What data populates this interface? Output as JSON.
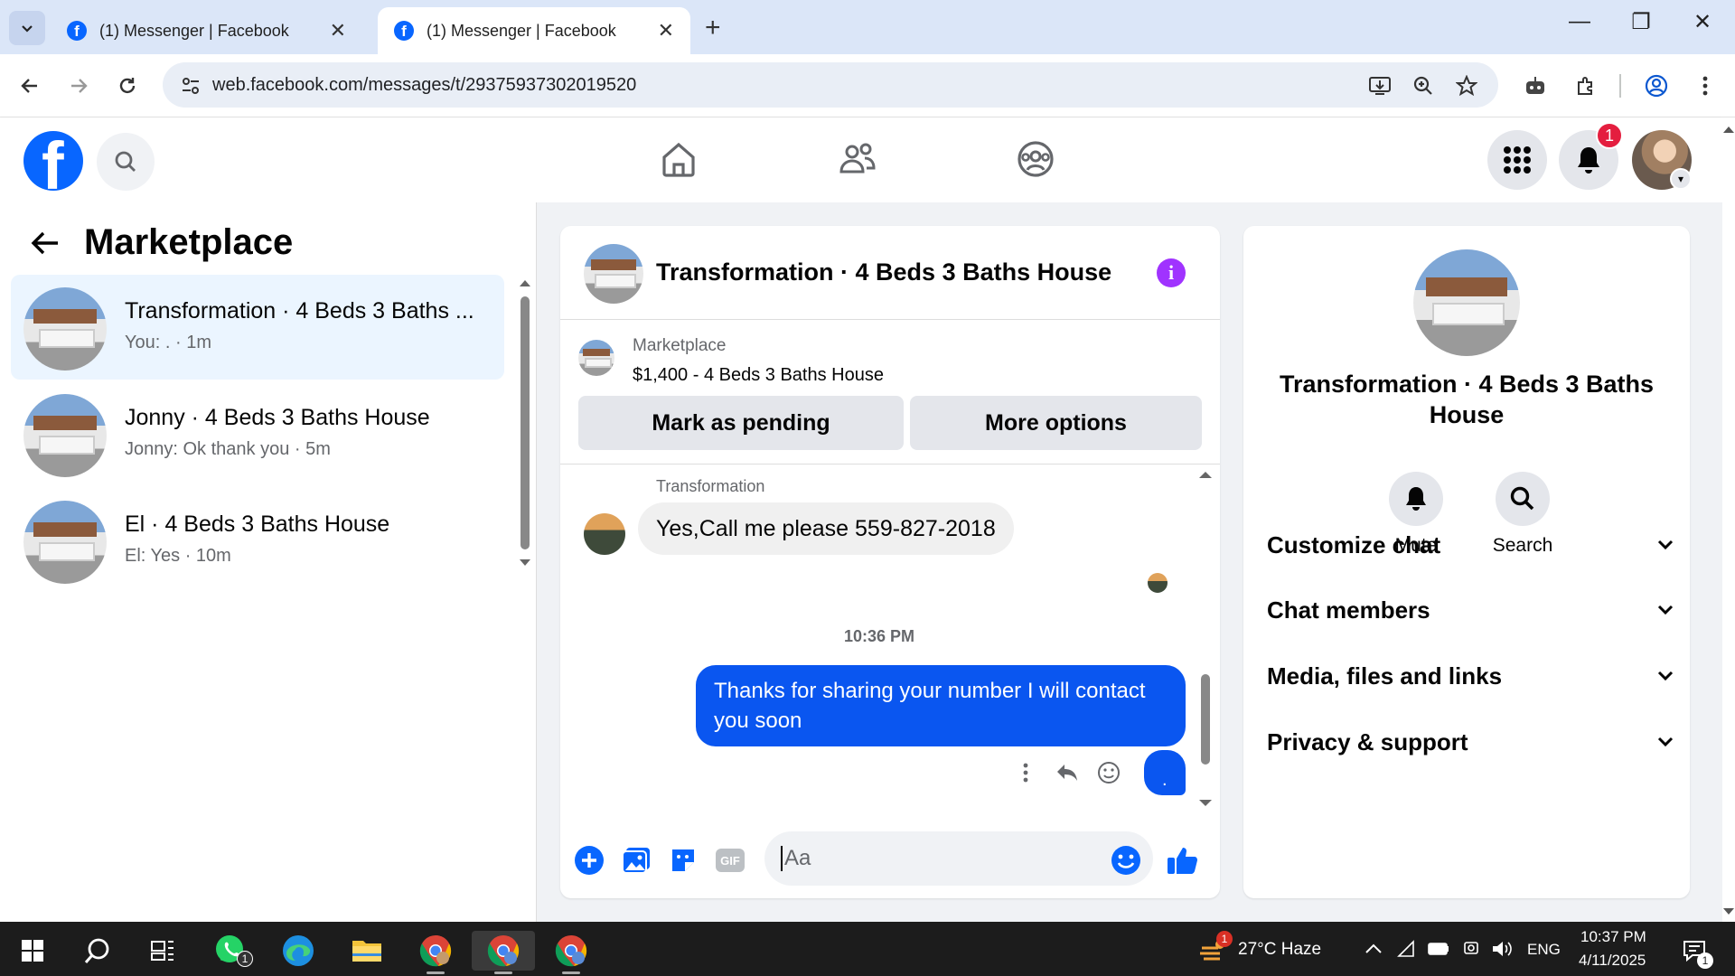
{
  "browser": {
    "tabs": [
      {
        "title": "(1) Messenger | Facebook",
        "active": false
      },
      {
        "title": "(1) Messenger | Facebook",
        "active": true
      }
    ],
    "url": "web.facebook.com/messages/t/29375937302019520"
  },
  "fb": {
    "logo_letter": "f",
    "notification_count": "1"
  },
  "left_panel": {
    "title": "Marketplace",
    "conversations": [
      {
        "name": "Transformation · 4 Beds 3 Baths ...",
        "snippet": "You: . · 1m",
        "active": true
      },
      {
        "name": "Jonny · 4 Beds 3 Baths House",
        "snippet": "Jonny: Ok thank you · 5m",
        "active": false
      },
      {
        "name": "El · 4 Beds 3 Baths House",
        "snippet": "El: Yes · 10m",
        "active": false
      }
    ]
  },
  "chat": {
    "title": "Transformation · 4 Beds 3 Baths House",
    "listing": {
      "category": "Marketplace",
      "price_title": "$1,400 - 4 Beds 3 Baths House",
      "mark_pending_label": "Mark as pending",
      "more_options_label": "More options"
    },
    "messages": {
      "sender": "Transformation",
      "incoming": "Yes,Call me please 559-827-2018",
      "timestamp": "10:36 PM",
      "outgoing": "Thanks for sharing your number I will contact you soon",
      "outgoing_mini": "."
    },
    "composer_placeholder": "Aa"
  },
  "right_panel": {
    "title": "Transformation · 4 Beds 3 Baths House",
    "actions": [
      {
        "label": "Mute",
        "icon": "bell-icon"
      },
      {
        "label": "Search",
        "icon": "search-icon"
      }
    ],
    "sections": [
      {
        "label": "Customize chat"
      },
      {
        "label": "Chat members"
      },
      {
        "label": "Media, files and links"
      },
      {
        "label": "Privacy & support"
      }
    ]
  },
  "taskbar": {
    "whatsapp_badge": "1",
    "weather_badge": "1",
    "weather": "27°C  Haze",
    "language": "ENG",
    "time": "10:37 PM",
    "date": "4/11/2025",
    "notification_badge": "1"
  },
  "colors": {
    "fb_blue": "#0866ff",
    "messenger_blue": "#0a56f0",
    "info_purple": "#a033ff",
    "notif_red": "#e41e3f"
  }
}
